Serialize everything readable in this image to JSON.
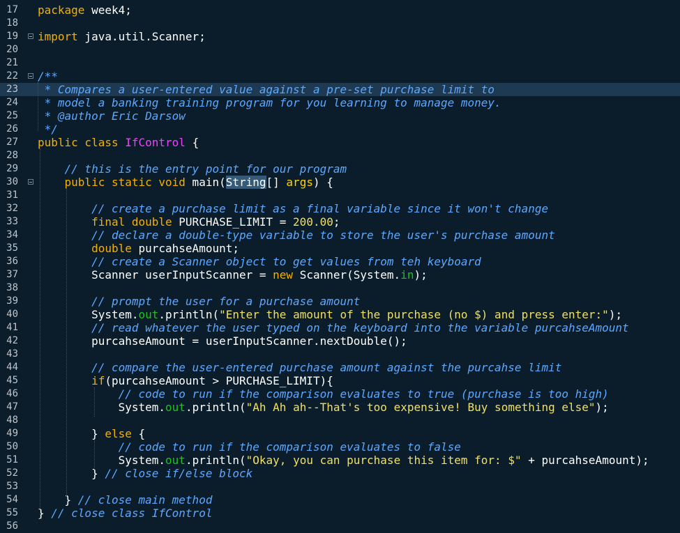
{
  "editor": {
    "language": "Java",
    "line_numbers": [
      "17",
      "18",
      "19",
      "20",
      "21",
      "22",
      "23",
      "24",
      "25",
      "26",
      "27",
      "28",
      "29",
      "30",
      "31",
      "32",
      "33",
      "34",
      "35",
      "36",
      "37",
      "38",
      "39",
      "40",
      "41",
      "42",
      "43",
      "44",
      "45",
      "46",
      "47",
      "48",
      "49",
      "50",
      "51",
      "52",
      "53",
      "54",
      "55",
      "56"
    ],
    "lines": [
      [
        {
          "t": "package",
          "s": "kw"
        },
        {
          "t": " week4;",
          "s": "pl"
        }
      ],
      [],
      [
        {
          "t": "import",
          "s": "kw"
        },
        {
          "t": " java.util.Scanner;",
          "s": "pl"
        }
      ],
      [],
      [],
      [
        {
          "t": "/**",
          "s": "cm"
        }
      ],
      [
        {
          "t": " * Compares a user-entered value against a pre-set purchase limit to",
          "s": "cm"
        }
      ],
      [
        {
          "t": " * model a banking training program for you learning to manage money.",
          "s": "cm"
        }
      ],
      [
        {
          "t": " * @author Eric Darsow",
          "s": "cm"
        }
      ],
      [
        {
          "t": " */",
          "s": "cm"
        }
      ],
      [
        {
          "t": "public class ",
          "s": "kw"
        },
        {
          "t": "IfControl",
          "s": "cls"
        },
        {
          "t": " {",
          "s": "pl"
        }
      ],
      [],
      [
        {
          "t": "    // this is the entry point for our program",
          "s": "cm"
        }
      ],
      [
        {
          "t": "    ",
          "s": "pl"
        },
        {
          "t": "public static void",
          "s": "kw"
        },
        {
          "t": " main(",
          "s": "pl"
        },
        {
          "t": "String",
          "s": "sel"
        },
        {
          "t": "[] ",
          "s": "pl"
        },
        {
          "t": "args",
          "s": "prm"
        },
        {
          "t": ") {",
          "s": "pl"
        }
      ],
      [],
      [
        {
          "t": "        // create a purchase limit as a final variable since it won't change",
          "s": "cm"
        }
      ],
      [
        {
          "t": "        ",
          "s": "pl"
        },
        {
          "t": "final double",
          "s": "kw"
        },
        {
          "t": " PURCHASE_LIMIT = ",
          "s": "pl"
        },
        {
          "t": "200.00",
          "s": "num"
        },
        {
          "t": ";",
          "s": "pl"
        }
      ],
      [
        {
          "t": "        // declare a double-type variable to store the user's purchase amount",
          "s": "cm"
        }
      ],
      [
        {
          "t": "        ",
          "s": "pl"
        },
        {
          "t": "double",
          "s": "kw"
        },
        {
          "t": " purcahseAmount;",
          "s": "pl"
        }
      ],
      [
        {
          "t": "        // create a Scanner object to get values from teh keyboard",
          "s": "cm"
        }
      ],
      [
        {
          "t": "        Scanner userInputScanner = ",
          "s": "pl"
        },
        {
          "t": "new",
          "s": "kw"
        },
        {
          "t": " Scanner(System.",
          "s": "pl"
        },
        {
          "t": "in",
          "s": "fld"
        },
        {
          "t": ");",
          "s": "pl"
        }
      ],
      [],
      [
        {
          "t": "        // prompt the user for a purchase amount",
          "s": "cm"
        }
      ],
      [
        {
          "t": "        System.",
          "s": "pl"
        },
        {
          "t": "out",
          "s": "fld"
        },
        {
          "t": ".println(",
          "s": "pl"
        },
        {
          "t": "\"Enter the amount of the purchase (no $) and press enter:\"",
          "s": "str"
        },
        {
          "t": ");",
          "s": "pl"
        }
      ],
      [
        {
          "t": "        // read whatever the user typed on the keyboard into the variable purcahseAmount",
          "s": "cm"
        }
      ],
      [
        {
          "t": "        purcahseAmount = userInputScanner.nextDouble();",
          "s": "pl"
        }
      ],
      [],
      [
        {
          "t": "        // compare the user-entered purchase amount against the purcahse limit",
          "s": "cm"
        }
      ],
      [
        {
          "t": "        ",
          "s": "pl"
        },
        {
          "t": "if",
          "s": "kw"
        },
        {
          "t": "(purcahseAmount > PURCHASE_LIMIT){",
          "s": "pl"
        }
      ],
      [
        {
          "t": "            // code to run if the comparison evaluates to true (purchase is too high)",
          "s": "cm"
        }
      ],
      [
        {
          "t": "            System.",
          "s": "pl"
        },
        {
          "t": "out",
          "s": "fld"
        },
        {
          "t": ".println(",
          "s": "pl"
        },
        {
          "t": "\"Ah Ah ah--That's too expensive! Buy something else\"",
          "s": "str"
        },
        {
          "t": ");",
          "s": "pl"
        }
      ],
      [],
      [
        {
          "t": "        } ",
          "s": "pl"
        },
        {
          "t": "else",
          "s": "kw"
        },
        {
          "t": " {",
          "s": "pl"
        }
      ],
      [
        {
          "t": "            // code to run if the comparison evaluates to false",
          "s": "cm"
        }
      ],
      [
        {
          "t": "            System.",
          "s": "pl"
        },
        {
          "t": "out",
          "s": "fld"
        },
        {
          "t": ".println(",
          "s": "pl"
        },
        {
          "t": "\"Okay, you can purchase this item for: $\"",
          "s": "str"
        },
        {
          "t": " + purcahseAmount);",
          "s": "pl"
        }
      ],
      [
        {
          "t": "        } ",
          "s": "pl"
        },
        {
          "t": "// close if/else block",
          "s": "cm"
        }
      ],
      [],
      [
        {
          "t": "    } ",
          "s": "pl"
        },
        {
          "t": "// close main method",
          "s": "cm"
        }
      ],
      [
        {
          "t": "} ",
          "s": "pl"
        },
        {
          "t": "// close class IfControl",
          "s": "cm"
        }
      ],
      []
    ],
    "highlighted_line": "23",
    "fold_markers": [
      "19",
      "22",
      "30"
    ],
    "colors": {
      "background": "#0b1d2b",
      "keyword": "#f5b000",
      "comment": "#5da8ff",
      "string": "#f0e060",
      "class_name": "#f040ff",
      "static_field": "#20c020",
      "plain": "#ffffff"
    }
  }
}
